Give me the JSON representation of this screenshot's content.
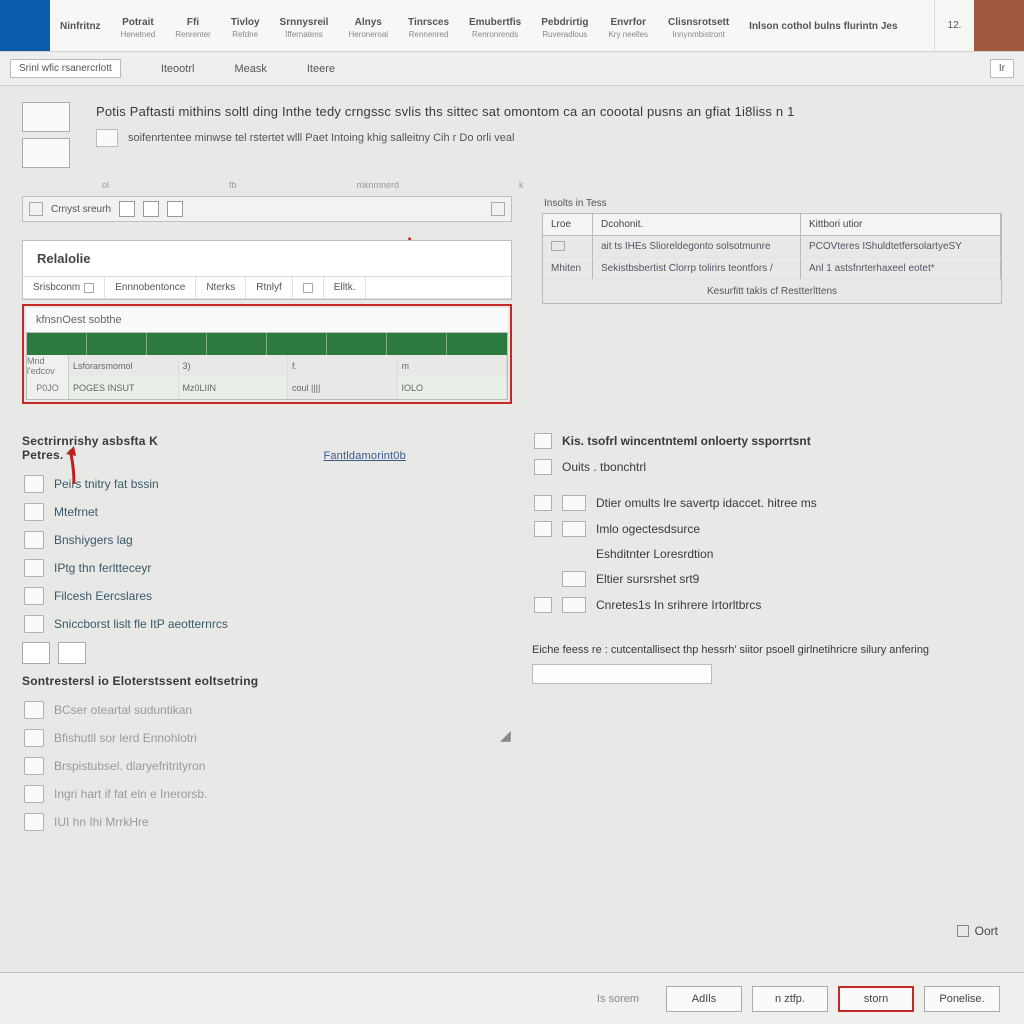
{
  "ribbon": {
    "tabs": [
      {
        "t": "Ninfritnz",
        "s": ""
      },
      {
        "t": "Potrait",
        "s": "Henetned"
      },
      {
        "t": "Ffi",
        "s": "Renrenter"
      },
      {
        "t": "Tivloy",
        "s": "Refdne"
      },
      {
        "t": "Srnnysreil",
        "s": "Iffernatens"
      },
      {
        "t": "Alnys",
        "s": "Heroneroal"
      },
      {
        "t": "Tinrsces",
        "s": "Rennenred"
      },
      {
        "t": "Emubertfis",
        "s": "Renronrends"
      },
      {
        "t": "Pebdrirtig",
        "s": "Ruveradlous"
      },
      {
        "t": "Envrfor",
        "s": "Kry neelles"
      },
      {
        "t": "Clisnsrotsett",
        "s": "Innynmbistront"
      },
      {
        "t": "Inlson cothol bulns flurintn Jes",
        "s": ""
      }
    ],
    "num": "12.",
    "sub": {
      "box": "Srinl wfic rsanercrlott",
      "a": "Iteootrl",
      "b": "Meask",
      "c": "Iteere"
    }
  },
  "intro": {
    "line1": "Potis Paftasti mithins soltl ding Inthe tedy crngssc svlis ths sittec sat omontom ca an coootal pusns an gfiat 1i8liss n 1",
    "line2": "soifenrtentee minwse tel rstertet wlll Paet Intoing khig salleitny Cih r Do orli veal",
    "mini": [
      "ol",
      "fb",
      "mknmnerd",
      "k"
    ]
  },
  "callout": {
    "head": "Crnyst sreurh",
    "title": "Relalolie",
    "tabs": [
      "Srisbconm",
      "Ennnobentonce",
      "Nterks",
      "Rtnlyf",
      "",
      "Elltk."
    ],
    "redTitle": "kfnsnOest sobthe",
    "row1": {
      "label": "Mnd l'edcov",
      "a": "Lsforarsmomol",
      "b": "3)",
      "c": "f.",
      "d": "m"
    },
    "row2": {
      "label": "P0JO",
      "a": "POGES INSUT",
      "b": "Mz0LIIN",
      "c": "coul ||||",
      "d": "IOLO"
    }
  },
  "rtable": {
    "head": "Insolts in Tess",
    "cols": [
      "Lroe",
      "Dcohonit.",
      "Kittbori utior"
    ],
    "rows": [
      {
        "a": "",
        "b": "ait ts IHEs Slioreldegonto solsotmunre",
        "c": "PCOVteres IShuldtetfersolartyeSY"
      },
      {
        "a": "Mhiten",
        "b": "Sekistbsbertist Clorrp tolirirs teontfors   /",
        "c": "Anl 1 astsfnrterhaxeel eotet*"
      }
    ],
    "foot": "Kesurfitt takIs cf Restterlttens"
  },
  "leftList": {
    "head": "Sectrirnrishy asbsfta K Petres.",
    "link": "Fantldamorint0b",
    "items": [
      "Peirs tnitry fat bssin",
      "Mtefrnet",
      "Bnshiygers lag",
      "IPtg thn ferltteceyr",
      "Filcesh Eercslares",
      "Sniccborst lislt fle ItP aeotternrcs"
    ],
    "head2": "Sontrestersl io Eloterstssent eoltsetring",
    "items2": [
      "BCser oteartal suduntikan",
      "Bfishutll sor lerd Ennohlotri",
      "Brspistubsel. dlaryefritrityron",
      "Ingri hart if fat eln e Inerorsb.",
      "IUI hn Ihi MrrkHre"
    ]
  },
  "rightList": {
    "top": "Kis. tsofrl wincentntemI onloerty ssporrtsnt",
    "items": [
      "Ouits . tbonchtrl",
      "Dtier omults lre savertp idaccet. hitree ms",
      "Imlo ogectesdsurce",
      "Eshditnter Loresrdtion",
      "Eltier sursrshet srt9",
      "Cnretes1s In srihrere Irtorltbrcs"
    ],
    "note": "Eiche feess re : cutcentallisect thp hessrh' siitor psoell girlnetihricre silury anfering"
  },
  "footer": {
    "opt": "Oort",
    "btns": [
      "Is sorem",
      "AdIls",
      "n ztfp.",
      "storn",
      "Ponelise."
    ]
  }
}
